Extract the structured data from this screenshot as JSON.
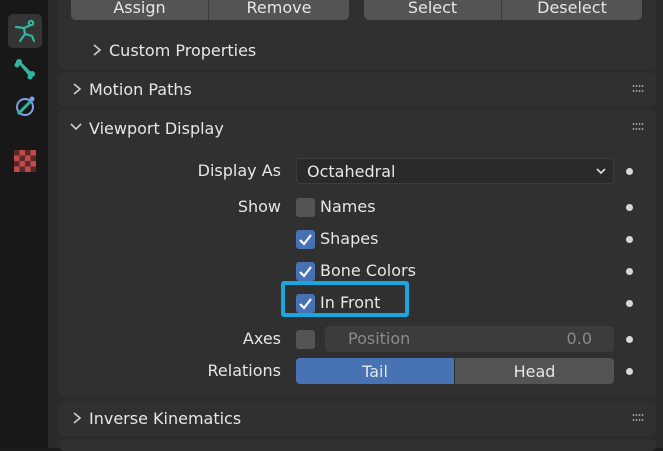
{
  "top_buttons": {
    "assign": "Assign",
    "remove": "Remove",
    "select": "Select",
    "deselect": "Deselect"
  },
  "custom_properties": "Custom Properties",
  "panels": {
    "motion_paths": "Motion Paths",
    "viewport_display": "Viewport Display",
    "inverse_kinematics": "Inverse Kinematics"
  },
  "viewport": {
    "display_as_label": "Display As",
    "display_as_value": "Octahedral",
    "show_label": "Show",
    "names": {
      "label": "Names",
      "checked": false
    },
    "shapes": {
      "label": "Shapes",
      "checked": true
    },
    "bone_colors": {
      "label": "Bone Colors",
      "checked": true
    },
    "in_front": {
      "label": "In Front",
      "checked": true
    },
    "axes_label": "Axes",
    "axes_checked": false,
    "position_label": "Position",
    "position_value": "0.0",
    "relations_label": "Relations",
    "relations_tail": "Tail",
    "relations_head": "Head",
    "relations_selected": "Tail"
  },
  "colors": {
    "accent_blue": "#4772b3",
    "highlight_cyan": "#1aa7e0"
  },
  "icons": [
    "pose-icon",
    "bone-icon",
    "bone-constraint-icon",
    "texture-icon",
    "chevron-right-icon",
    "chevron-down-icon",
    "drag-handle-icon",
    "check-icon",
    "keyframe-dot-icon"
  ]
}
